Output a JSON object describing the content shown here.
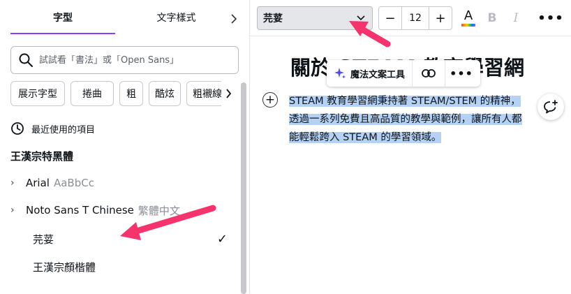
{
  "left_panel": {
    "tabs": [
      {
        "label": "字型",
        "active": true
      },
      {
        "label": "文字樣式",
        "active": false
      }
    ],
    "search": {
      "placeholder": "試試看「書法」或「Open Sans」",
      "value": ""
    },
    "chips": [
      "展示字型",
      "捲曲",
      "粗",
      "酷炫",
      "粗襯線體"
    ],
    "recent_header": "最近使用的項目",
    "fonts": [
      {
        "name": "王漢宗特黑體",
        "sample": "",
        "expandable": false,
        "selected": false
      },
      {
        "name": "Arial",
        "sample": "AaBbCc",
        "expandable": true,
        "selected": false
      },
      {
        "name": "Noto Sans T Chinese",
        "sample": "繁體中文",
        "expandable": true,
        "selected": false
      },
      {
        "name": "芫荽",
        "sample": "",
        "expandable": false,
        "selected": true
      },
      {
        "name": "王漢宗顏楷體",
        "sample": "",
        "expandable": false,
        "selected": false
      }
    ],
    "checkmark": "✓",
    "accent_color": "#8b3dff"
  },
  "toolbar": {
    "font_name": "芫荽",
    "font_chevron": "⌄",
    "size_minus": "−",
    "size_value": "12",
    "size_plus": "+",
    "text_color_label": "A",
    "bold_label": "B",
    "italic_label": "I",
    "more_label": "•••"
  },
  "canvas": {
    "heading": "關於 STEAM 教育學習網",
    "floating_menu": {
      "magic_label": "魔法文案工具",
      "link_icon": "link-icon",
      "more_label": "•••"
    },
    "add_label": "+",
    "body_text": "STEAM 教育學習網秉持著 STEAM/STEM 的精神，透過一系列免費且高品質的教學與範例，讓所有人都能輕鬆跨入 STEAM 的學習領域。",
    "selection_color": "#b5d2f4"
  },
  "annotations": {
    "arrow_color": "#f7336e"
  }
}
